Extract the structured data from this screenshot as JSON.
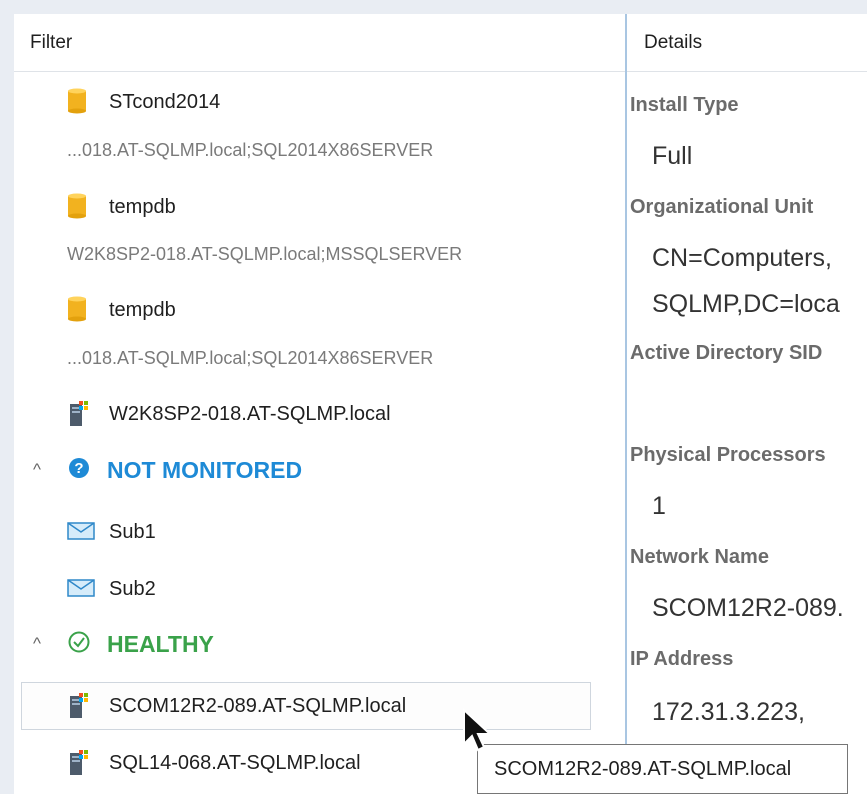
{
  "left_panel": {
    "header": "Filter",
    "items": [
      {
        "label": "STcond2014",
        "sub": "...018.AT-SQLMP.local;SQL2014X86SERVER",
        "icon": "database-icon"
      },
      {
        "label": "tempdb",
        "sub": "W2K8SP2-018.AT-SQLMP.local;MSSQLSERVER",
        "icon": "database-icon"
      },
      {
        "label": "tempdb",
        "sub": "...018.AT-SQLMP.local;SQL2014X86SERVER",
        "icon": "database-icon"
      },
      {
        "label": "W2K8SP2-018.AT-SQLMP.local",
        "icon": "server-icon"
      }
    ],
    "groups": {
      "not_monitored": {
        "label": "NOT MONITORED",
        "icon": "question-circle-icon",
        "color": "#1e8ad6",
        "items": [
          {
            "label": "Sub1",
            "icon": "subscription-envelope-icon"
          },
          {
            "label": "Sub2",
            "icon": "subscription-envelope-icon"
          }
        ]
      },
      "healthy": {
        "label": "HEALTHY",
        "icon": "check-circle-icon",
        "color": "#3aa24a",
        "items": [
          {
            "label": "SCOM12R2-089.AT-SQLMP.local",
            "icon": "server-icon"
          },
          {
            "label": "SQL14-068.AT-SQLMP.local",
            "icon": "server-icon"
          }
        ]
      }
    }
  },
  "right_panel": {
    "header": "Details",
    "fields": [
      {
        "label": "Install Type",
        "value": "Full"
      },
      {
        "label": "Organizational Unit",
        "value_lines": [
          "CN=Computers,",
          "SQLMP,DC=loca"
        ]
      },
      {
        "label": "Active Directory SID",
        "value": ""
      },
      {
        "label": "Physical Processors",
        "value": "1"
      },
      {
        "label": "Network Name",
        "value": "SCOM12R2-089."
      },
      {
        "label": "IP Address",
        "value_lines": [
          "172.31.3.223,"
        ]
      }
    ]
  },
  "tooltip": {
    "text": "SCOM12R2-089.AT-SQLMP.local"
  }
}
